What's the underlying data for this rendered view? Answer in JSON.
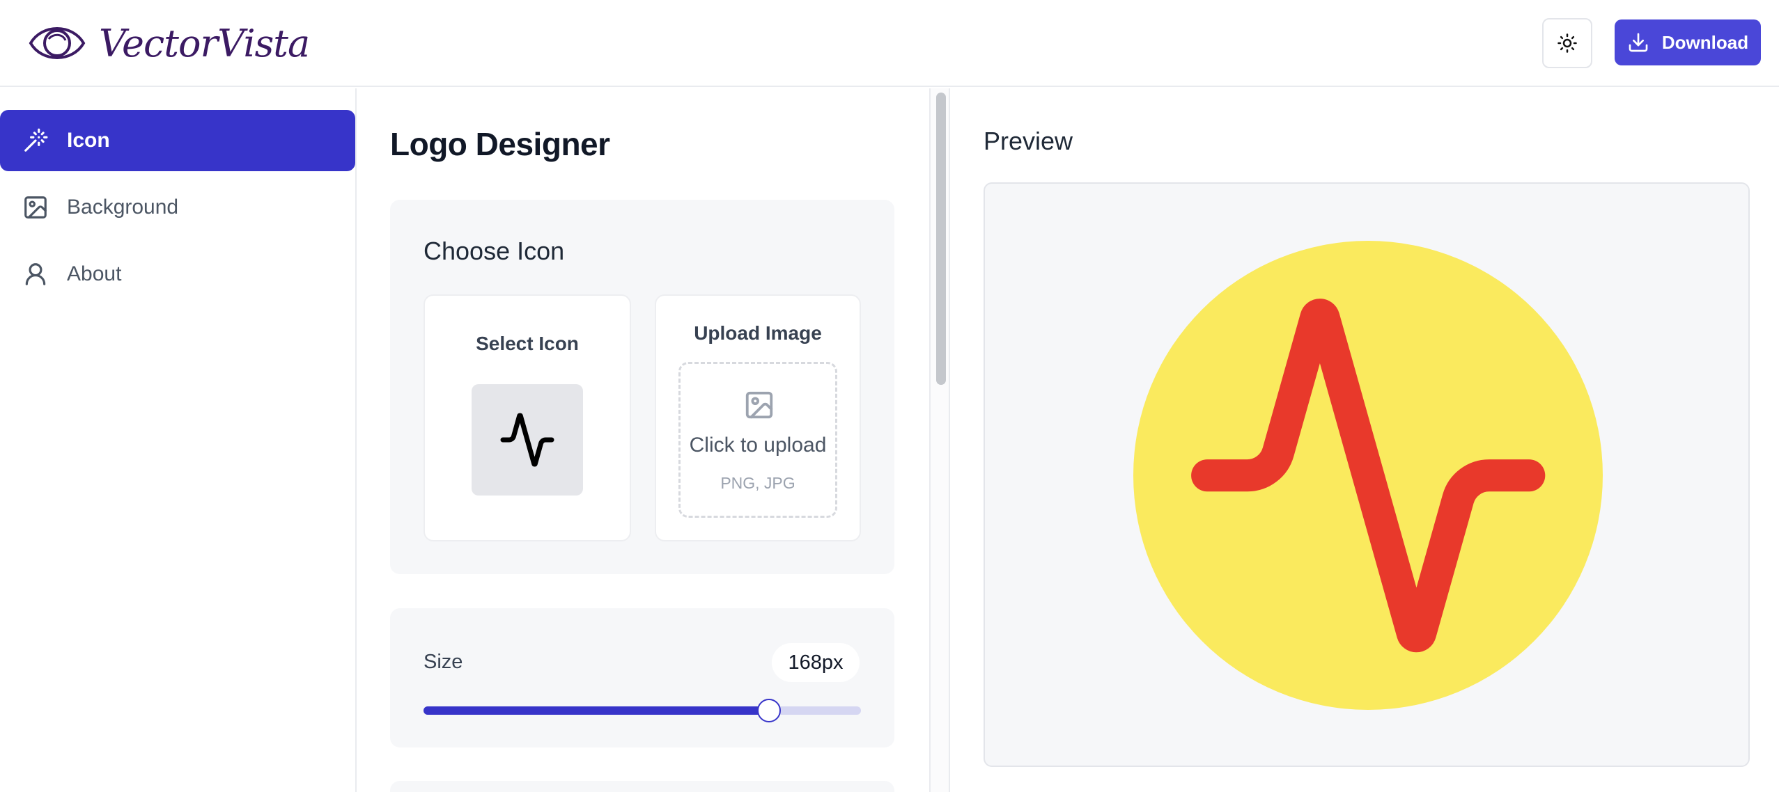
{
  "app": {
    "name": "VectorVista"
  },
  "header": {
    "download_label": "Download"
  },
  "sidebar": {
    "items": [
      {
        "label": "Icon",
        "icon": "magic-wand-icon",
        "active": true
      },
      {
        "label": "Background",
        "icon": "image-icon",
        "active": false
      },
      {
        "label": "About",
        "icon": "user-icon",
        "active": false
      }
    ]
  },
  "designer": {
    "title": "Logo Designer",
    "choose_icon": {
      "title": "Choose Icon",
      "select_label": "Select Icon",
      "selected_icon": "activity-icon",
      "upload_label": "Upload Image",
      "upload_prompt": "Click to upload",
      "upload_formats": "PNG, JPG"
    },
    "size": {
      "label": "Size",
      "value_display": "168px",
      "slider_fraction": 0.79
    }
  },
  "preview": {
    "title": "Preview",
    "background_color": "#faea5e",
    "icon_color": "#e8392b",
    "icon": "activity-icon"
  },
  "colors": {
    "accent": "#3734c9",
    "button": "#4a47d8"
  }
}
